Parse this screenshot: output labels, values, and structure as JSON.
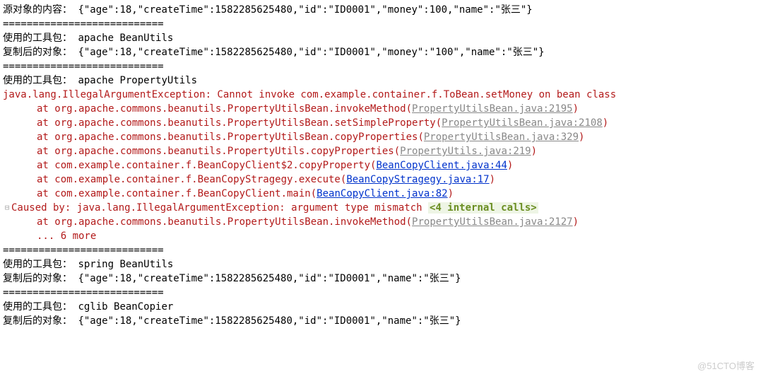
{
  "lines": {
    "l1_label": "源对象的内容：",
    "l1_json": "{\"age\":18,\"createTime\":1582285625480,\"id\":\"ID0001\",\"money\":100,\"name\":\"张三\"}",
    "sep": "===========================",
    "l3_label": "使用的工具包：",
    "l3_tool": "apache BeanUtils",
    "l4_label": "复制后的对象：",
    "l4_json": "{\"age\":18,\"createTime\":1582285625480,\"id\":\"ID0001\",\"money\":\"100\",\"name\":\"张三\"}",
    "l6_label": "使用的工具包：",
    "l6_tool": "apache PropertyUtils",
    "exc_msg": "java.lang.IllegalArgumentException: Cannot invoke com.example.container.f.ToBean.setMoney on bean class",
    "at1_call": "at org.apache.commons.beanutils.PropertyUtilsBean.invokeMethod",
    "at1_link": "PropertyUtilsBean.java:2195",
    "at2_call": "at org.apache.commons.beanutils.PropertyUtilsBean.setSimpleProperty",
    "at2_link": "PropertyUtilsBean.java:2108",
    "at3_call": "at org.apache.commons.beanutils.PropertyUtilsBean.copyProperties",
    "at3_link": "PropertyUtilsBean.java:329",
    "at4_call": "at org.apache.commons.beanutils.PropertyUtils.copyProperties",
    "at4_link": "PropertyUtils.java:219",
    "at5_call": "at com.example.container.f.BeanCopyClient$2.copyProperty",
    "at5_link": "BeanCopyClient.java:44",
    "at6_call": "at com.example.container.f.BeanCopyStragegy.execute",
    "at6_link": "BeanCopyStragegy.java:17",
    "at7_call": "at com.example.container.f.BeanCopyClient.main",
    "at7_link": "BeanCopyClient.java:82",
    "caused_by": "Caused by: java.lang.IllegalArgumentException: argument type mismatch ",
    "internal_calls": "<4 internal calls>",
    "at8_call": "at org.apache.commons.beanutils.PropertyUtilsBean.invokeMethod",
    "at8_link": "PropertyUtilsBean.java:2127",
    "more": "... 6 more",
    "l18_label": "使用的工具包：",
    "l18_tool": "spring BeanUtils",
    "l19_label": "复制后的对象：",
    "l19_json": "{\"age\":18,\"createTime\":1582285625480,\"id\":\"ID0001\",\"name\":\"张三\"}",
    "l21_label": "使用的工具包：",
    "l21_tool": "cglib BeanCopier",
    "l22_label": "复制后的对象：",
    "l22_json": "{\"age\":18,\"createTime\":1582285625480,\"id\":\"ID0001\",\"name\":\"张三\"}",
    "collapse_icon": "⊟"
  },
  "watermark": "@51CTO博客"
}
